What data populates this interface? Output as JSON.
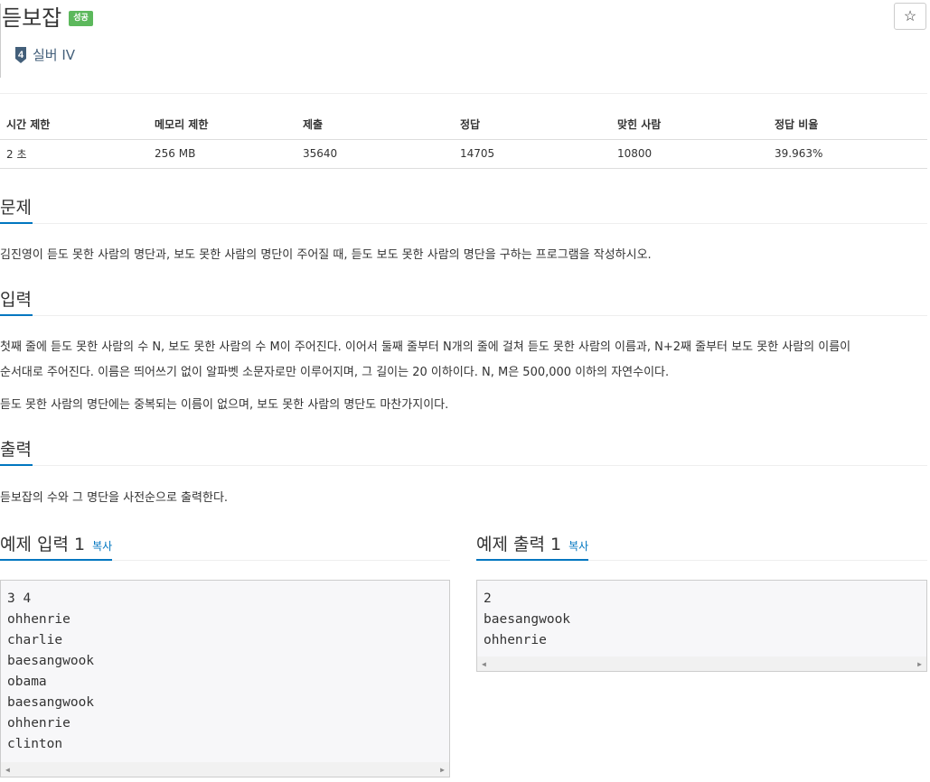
{
  "header": {
    "title": "듣보잡",
    "badge": "성공",
    "star": "☆",
    "tier_number": "4",
    "tier_label": "실버 IV"
  },
  "info_table": {
    "headers": [
      "시간 제한",
      "메모리 제한",
      "제출",
      "정답",
      "맞힌 사람",
      "정답 비율"
    ],
    "row": [
      "2 초",
      "256 MB",
      "35640",
      "14705",
      "10800",
      "39.963%"
    ]
  },
  "sections": {
    "problem": {
      "heading": "문제",
      "text": "김진영이 듣도 못한 사람의 명단과, 보도 못한 사람의 명단이 주어질 때, 듣도 보도 못한 사람의 명단을 구하는 프로그램을 작성하시오."
    },
    "input": {
      "heading": "입력",
      "line1": "첫째 줄에 듣도 못한 사람의 수 N, 보도 못한 사람의 수 M이 주어진다. 이어서 둘째 줄부터 N개의 줄에 걸쳐 듣도 못한 사람의 이름과, N+2째 줄부터 보도 못한 사람의 이름이",
      "line2": "순서대로 주어진다. 이름은 띄어쓰기 없이 알파벳 소문자로만 이루어지며, 그 길이는 20 이하이다. N, M은 500,000 이하의 자연수이다.",
      "line3": "듣도 못한 사람의 명단에는 중복되는 이름이 없으며, 보도 못한 사람의 명단도 마찬가지이다."
    },
    "output": {
      "heading": "출력",
      "text": "듣보잡의 수와 그 명단을 사전순으로 출력한다."
    }
  },
  "samples": {
    "input": {
      "heading": "예제 입력 1",
      "copy": "복사",
      "content": "3 4\nohhenrie\ncharlie\nbaesangwook\nobama\nbaesangwook\nohhenrie\nclinton"
    },
    "output": {
      "heading": "예제 출력 1",
      "copy": "복사",
      "content": "2\nbaesangwook\nohhenrie"
    },
    "scroll_left": "◀",
    "scroll_right": "▶"
  },
  "colors": {
    "accent": "#0076c0",
    "badge_green": "#5cb85c",
    "tier_silver": "#435f7a"
  }
}
